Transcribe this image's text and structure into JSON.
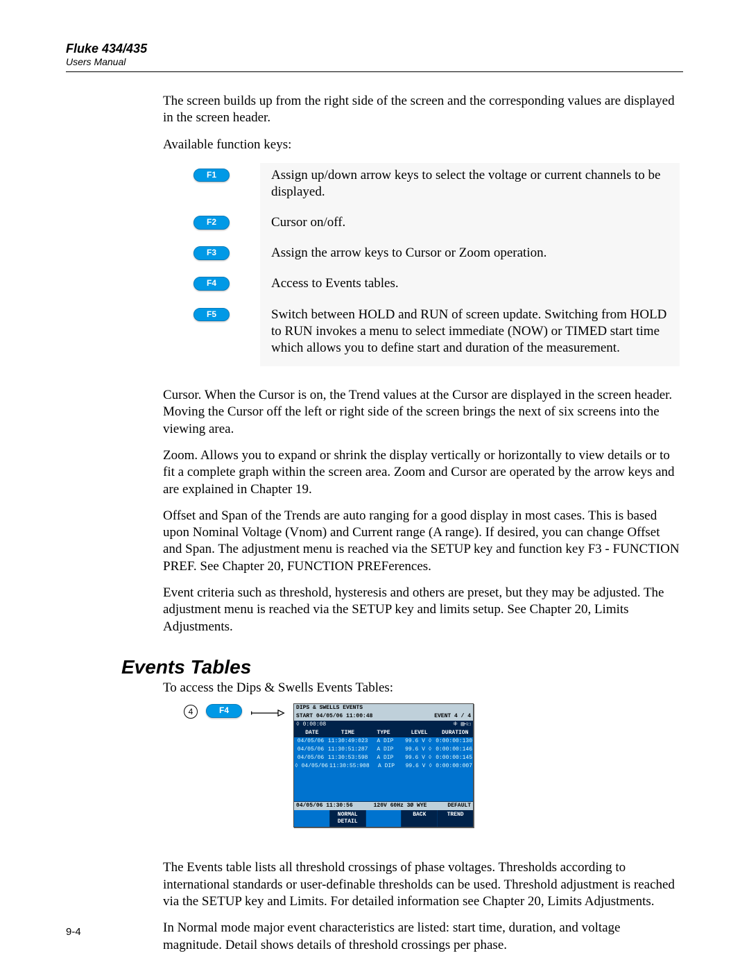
{
  "header": {
    "product": "Fluke 434/435",
    "doc": "Users Manual"
  },
  "intro": {
    "p1": "The screen builds up from the right side of the screen and the corresponding values are displayed in the screen header.",
    "p2": "Available function keys:"
  },
  "fnkeys": [
    {
      "key": "F1",
      "desc": "Assign up/down arrow keys to select the voltage or current channels to be displayed."
    },
    {
      "key": "F2",
      "desc": "Cursor on/off."
    },
    {
      "key": "F3",
      "desc": "Assign the arrow keys to Cursor or Zoom operation."
    },
    {
      "key": "F4",
      "desc": "Access to Events tables."
    },
    {
      "key": "F5",
      "desc": "Switch between HOLD and RUN of screen update. Switching from HOLD to RUN invokes a menu to select immediate (NOW) or TIMED start time which allows you to define start and duration of the measurement."
    }
  ],
  "explain": {
    "cursor": "Cursor. When the Cursor is on, the Trend values at the Cursor are displayed in the screen header. Moving the Cursor off the left or right side of the screen brings the next of six screens into the viewing area.",
    "zoom": "Zoom. Allows you to expand or shrink the display vertically or horizontally to view details or to fit a complete graph within the screen area. Zoom and Cursor are operated by the arrow keys and are explained in Chapter 19.",
    "offset": "Offset and Span of the Trends are auto ranging for a good display in most cases. This is based upon Nominal Voltage (Vnom) and Current range (A range). If desired, you can change Offset and Span. The adjustment menu is reached via the SETUP key and function key F3 - FUNCTION PREF. See Chapter 20, FUNCTION PREFerences.",
    "criteria": "Event criteria such as threshold, hysteresis and others are preset, but they may be adjusted. The adjustment menu is reached via the SETUP key and limits setup. See Chapter 20, Limits Adjustments."
  },
  "section_title": "Events Tables",
  "access_line": "To access the Dips & Swells Events Tables:",
  "step_number": "4",
  "step_key": "F4",
  "screen": {
    "title_left": "DIPS & SWELLS EVENTS",
    "start": "START 04/05/06  11:00:48",
    "elapsed": "◊  0:00:08",
    "event_right": "EVENT  4 / 4",
    "icons_right": "⁜  ▥∹☐",
    "cols": [
      "DATE",
      "TIME",
      "TYPE",
      "LEVEL",
      "DURATION"
    ],
    "rows": [
      [
        "04/05/06",
        "11:30:49:023",
        "A  DIP",
        "99.6 V ◊",
        "0:00:00:130"
      ],
      [
        "04/05/06",
        "11:30:51:287",
        "A  DIP",
        "99.6 V ◊",
        "0:00:00:146"
      ],
      [
        "04/05/06",
        "11:30:53:598",
        "A  DIP",
        "99.6 V ◊",
        "0:00:00:145"
      ],
      [
        "◊ 04/05/06",
        "11:30:55:908",
        "A  DIP",
        "99.6 V ◊",
        "0:00:00:007"
      ]
    ],
    "status_left": "04/05/06  11:30:56",
    "status_mid": "120V  60Hz 3Ø WYE",
    "status_right": "DEFAULT",
    "softkeys": [
      "",
      "NORMAL DETAIL",
      "",
      "BACK",
      "TREND"
    ]
  },
  "after": {
    "p1": "The Events table lists all threshold crossings of phase voltages. Thresholds according to international standards or user-definable thresholds can be used. Threshold adjustment is reached via the SETUP key and Limits. For detailed information see Chapter 20, Limits Adjustments.",
    "p2": "In Normal mode major event characteristics are listed: start time, duration, and voltage magnitude. Detail shows details of threshold crossings per phase."
  },
  "page_number": "9-4"
}
